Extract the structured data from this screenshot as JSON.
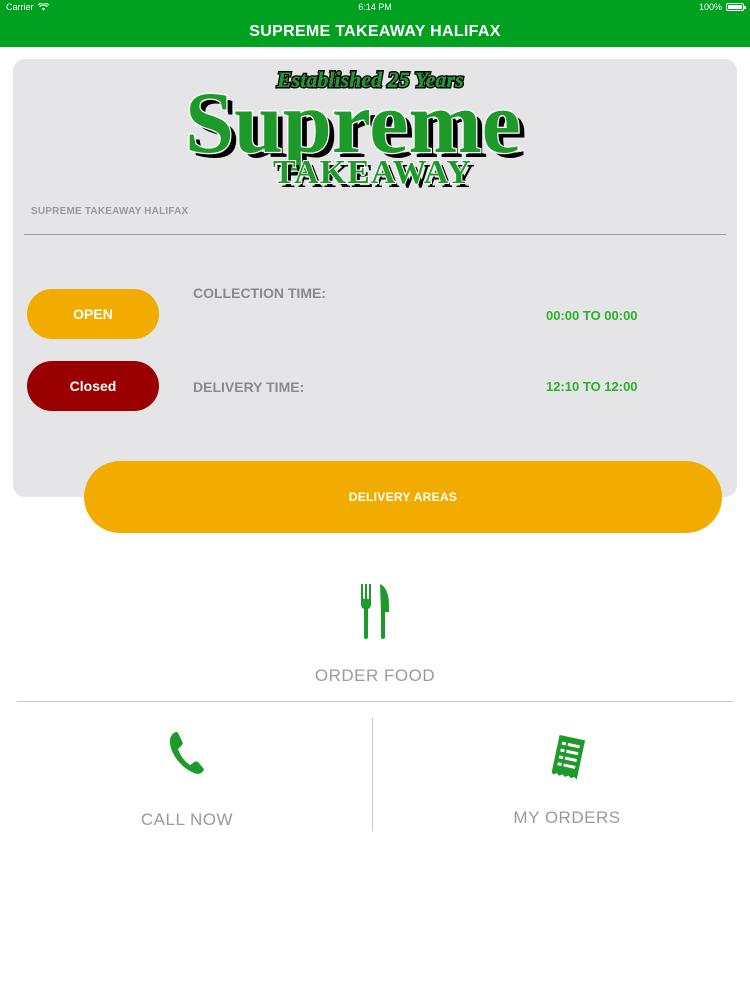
{
  "status_bar": {
    "carrier": "Carrier",
    "time": "6:14 PM",
    "battery": "100%"
  },
  "nav": {
    "title": "SUPREME TAKEAWAY HALIFAX"
  },
  "logo": {
    "tagline": "Established 25 Years",
    "brand": "Supreme",
    "sub": "TAKEAWAY"
  },
  "store": {
    "name": "SUPREME TAKEAWAY HALIFAX"
  },
  "status": {
    "open_label": "OPEN",
    "closed_label": "Closed",
    "collection_label": "COLLECTION TIME:",
    "collection_time": "00:00 TO 00:00",
    "delivery_label": "DELIVERY TIME:",
    "delivery_time": "12:10 TO 12:00"
  },
  "actions": {
    "delivery_areas": "DELIVERY AREAS"
  },
  "menu": {
    "order_food": "ORDER FOOD",
    "call_now": "CALL NOW",
    "my_orders": "MY ORDERS"
  },
  "icons": {
    "wifi": "wifi-icon",
    "battery": "battery-icon",
    "cutlery": "cutlery-icon",
    "phone": "phone-icon",
    "receipt": "receipt-icon"
  },
  "colors": {
    "brand_green": "#00a020",
    "open_amber": "#f2ac00",
    "closed_red": "#9b0000",
    "time_green": "#28b428"
  }
}
